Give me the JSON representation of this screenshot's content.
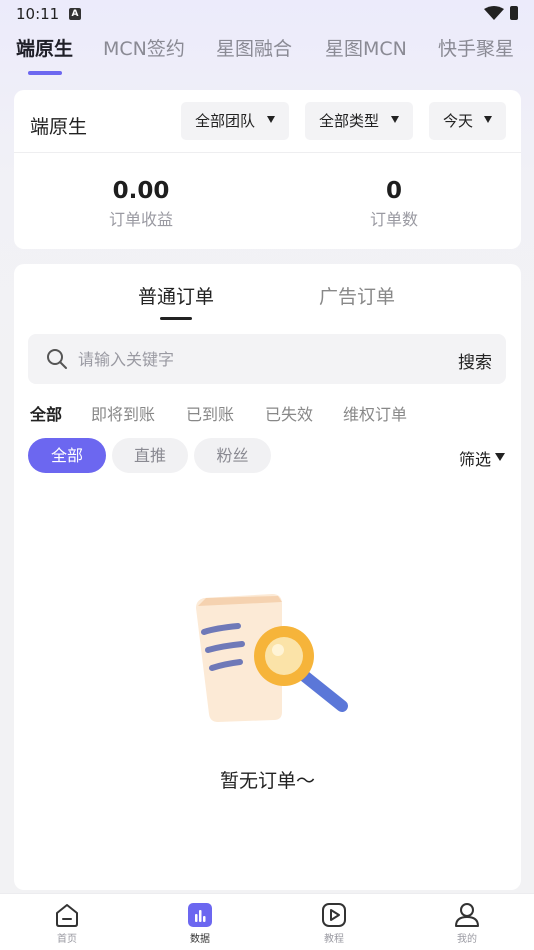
{
  "status_bar": {
    "time": "10:11"
  },
  "top_tabs": [
    {
      "label": "端原生",
      "active": true
    },
    {
      "label": "MCN签约",
      "active": false
    },
    {
      "label": "星图融合",
      "active": false
    },
    {
      "label": "星图MCN",
      "active": false
    },
    {
      "label": "快手聚星",
      "active": false
    }
  ],
  "summary": {
    "title": "端原生",
    "dropdowns": [
      {
        "label": "全部团队"
      },
      {
        "label": "全部类型"
      },
      {
        "label": "今天"
      }
    ],
    "stats": [
      {
        "value": "0.00",
        "label": "订单收益"
      },
      {
        "value": "0",
        "label": "订单数"
      }
    ]
  },
  "orders": {
    "tabs": [
      {
        "label": "普通订单",
        "active": true
      },
      {
        "label": "广告订单",
        "active": false
      }
    ],
    "search": {
      "placeholder": "请输入关键字",
      "button": "搜索"
    },
    "status_filters": [
      {
        "label": "全部",
        "active": true
      },
      {
        "label": "即将到账",
        "active": false
      },
      {
        "label": "已到账",
        "active": false
      },
      {
        "label": "已失效",
        "active": false
      },
      {
        "label": "维权订单",
        "active": false
      }
    ],
    "chips": [
      {
        "label": "全部",
        "active": true
      },
      {
        "label": "直推",
        "active": false
      },
      {
        "label": "粉丝",
        "active": false
      }
    ],
    "filter_label": "筛选",
    "empty_text": "暂无订单～"
  },
  "bottom_nav": [
    {
      "label": "首页",
      "icon": "home-icon",
      "active": false
    },
    {
      "label": "数据",
      "icon": "chart-icon",
      "active": true
    },
    {
      "label": "教程",
      "icon": "play-icon",
      "active": false
    },
    {
      "label": "我的",
      "icon": "user-icon",
      "active": false
    }
  ],
  "colors": {
    "accent": "#6C67F0",
    "background": "#F2F2F4"
  }
}
